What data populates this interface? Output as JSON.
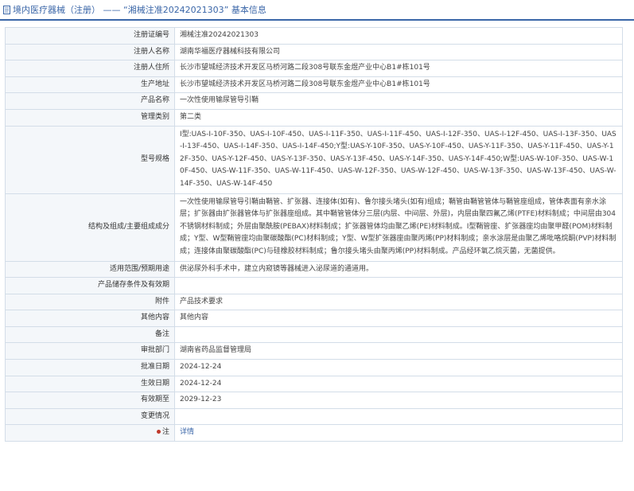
{
  "header": {
    "title": "境内医疗器械（注册） —— “湘械注准20242021303” 基本信息"
  },
  "rows": [
    {
      "label": "注册证编号",
      "value": "湘械注准20242021303"
    },
    {
      "label": "注册人名称",
      "value": "湖南华福医疗器械科技有限公司"
    },
    {
      "label": "注册人住所",
      "value": "长沙市望城经济技术开发区马桥河路二段308号联东金煜产业中心B1#栋101号"
    },
    {
      "label": "生产地址",
      "value": "长沙市望城经济技术开发区马桥河路二段308号联东金煜产业中心B1#栋101号"
    },
    {
      "label": "产品名称",
      "value": "一次性使用输尿管导引鞘"
    },
    {
      "label": "管理类别",
      "value": "第二类"
    },
    {
      "label": "型号规格",
      "value": "I型:UAS-I-10F-350、UAS-I-10F-450、UAS-I-11F-350、UAS-I-11F-450、UAS-I-12F-350、UAS-I-12F-450、UAS-I-13F-350、UAS-I-13F-450、UAS-I-14F-350、UAS-I-14F-450;Y型:UAS-Y-10F-350、UAS-Y-10F-450、UAS-Y-11F-350、UAS-Y-11F-450、UAS-Y-12F-350、UAS-Y-12F-450、UAS-Y-13F-350、UAS-Y-13F-450、UAS-Y-14F-350、UAS-Y-14F-450;W型:UAS-W-10F-350、UAS-W-10F-450、UAS-W-11F-350、UAS-W-11F-450、UAS-W-12F-350、UAS-W-12F-450、UAS-W-13F-350、UAS-W-13F-450、UAS-W-14F-350、UAS-W-14F-450"
    },
    {
      "label": "结构及组成/主要组成成分",
      "value": "一次性使用输尿管导引鞘由鞘管、扩张器、连接体(如有)、鲁尔接头堵头(如有)组成；鞘管由鞘管管体与鞘管座组成，管体表面有亲水涂层；扩张器由扩张器管体与扩张器座组成。其中鞘管管体分三层(内层、中间层、外层)，内层由聚四氟乙烯(PTFE)材料制成；中间层由304不锈钢材料制成；外层由聚酰胺(PEBAX)材料制成；扩张器管体均由聚乙烯(PE)材料制成。I型鞘管座、扩张器座均由聚甲醛(POM)材料制成；Y型、W型鞘管座均由聚碳酸酯(PC)材料制成；Y型、W型扩张器座由聚丙烯(PP)材料制成；亲水涂层是由聚乙烯吡咯烷酮(PVP)材料制成；连接体由聚碳酸酯(PC)与硅橡胶材料制成；鲁尔接头堵头由聚丙烯(PP)材料制成。产品经环氧乙烷灭菌，无菌提供。"
    },
    {
      "label": "适用范围/预期用途",
      "value": "供泌尿外科手术中，建立内窥镜等器械进入泌尿道的通道用。"
    },
    {
      "label": "产品储存条件及有效期",
      "value": ""
    },
    {
      "label": "附件",
      "value": "产品技术要求"
    },
    {
      "label": "其他内容",
      "value": "其他内容"
    },
    {
      "label": "备注",
      "value": ""
    },
    {
      "label": "审批部门",
      "value": "湖南省药品监督管理局"
    },
    {
      "label": "批准日期",
      "value": "2024-12-24"
    },
    {
      "label": "生效日期",
      "value": "2024-12-24"
    },
    {
      "label": "有效期至",
      "value": "2029-12-23"
    },
    {
      "label": "变更情况",
      "value": ""
    }
  ],
  "note": {
    "label": "注",
    "link_text": "详情"
  },
  "colors": {
    "accent": "#3a66a8",
    "label_bg": "#f4f7fa",
    "border": "#d3dde8"
  }
}
